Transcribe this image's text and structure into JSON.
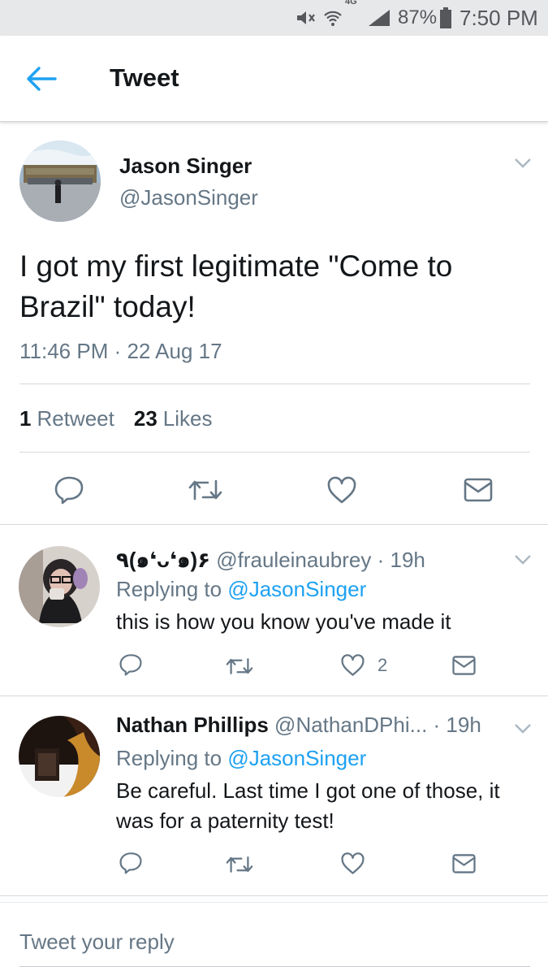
{
  "status_bar": {
    "battery": "87%",
    "time": "7:50 PM",
    "network": "4G",
    "icons": [
      "mute-icon",
      "wifi-icon",
      "signal-icon",
      "battery-icon"
    ]
  },
  "header": {
    "title": "Tweet",
    "back_icon": "arrow-left-icon"
  },
  "tweet": {
    "author_name": "Jason Singer",
    "author_handle": "@JasonSinger",
    "text": "I got my first legitimate \"Come to Brazil\" today!",
    "timestamp": "11:46 PM · 22 Aug 17",
    "retweet_count": "1",
    "retweet_label": "Retweet",
    "like_count": "23",
    "like_label": "Likes",
    "actions": [
      "reply-icon",
      "retweet-icon",
      "like-icon",
      "message-icon"
    ]
  },
  "replies": [
    {
      "name": "٩(๑❛ᴗ❛๑)۶",
      "handle": "@frauleinaubrey",
      "time": "· 19h",
      "replying_label": "Replying to",
      "replying_to": "@JasonSinger",
      "text": "this is how you know you've made it",
      "like_count": "2"
    },
    {
      "name": "Nathan Phillips",
      "handle": "@NathanDPhi...",
      "time": "· 19h",
      "replying_label": "Replying to",
      "replying_to": "@JasonSinger",
      "text": "Be careful. Last time I got one of those, it was for a paternity test!",
      "like_count": ""
    }
  ],
  "compose": {
    "placeholder": "Tweet your reply"
  },
  "colors": {
    "accent": "#1da1f2",
    "secondary_text": "#657786",
    "primary_text": "#14171a"
  }
}
